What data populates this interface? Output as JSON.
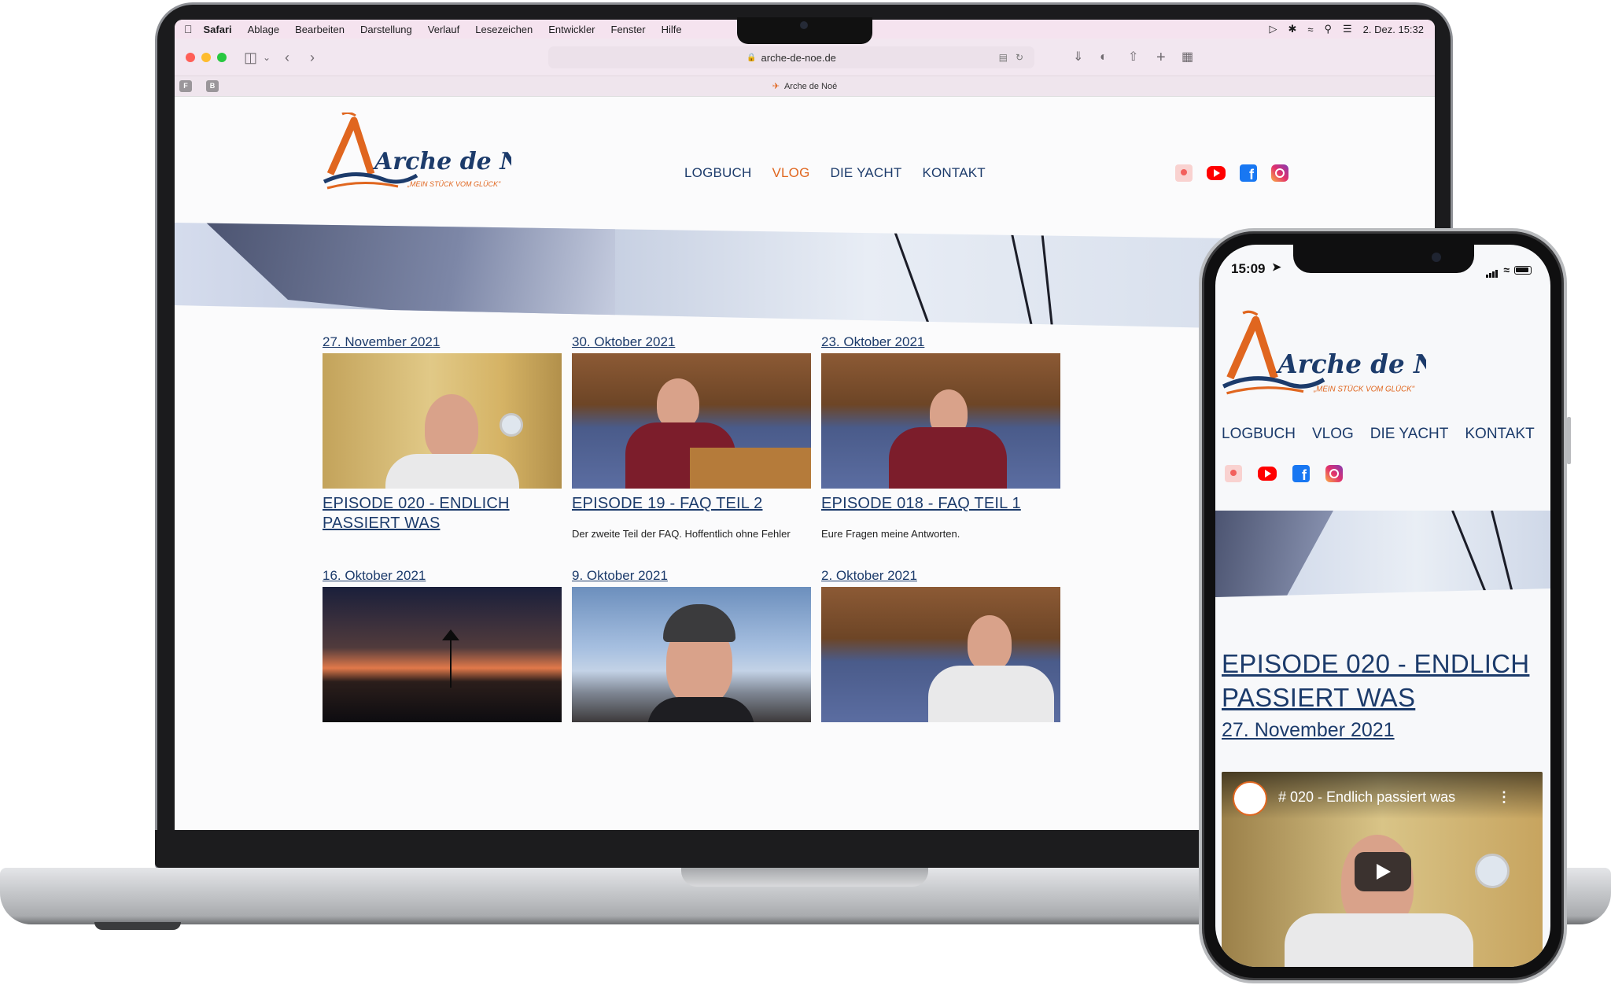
{
  "colors": {
    "navy": "#1c3b6b",
    "accent_orange": "#e0661f",
    "menubar_pink": "#f5e3ef"
  },
  "menubar": {
    "apple_icon": "apple-icon",
    "items": [
      "Safari",
      "Ablage",
      "Bearbeiten",
      "Darstellung",
      "Verlauf",
      "Lesezeichen",
      "Entwickler",
      "Fenster",
      "Hilfe"
    ],
    "clock": "2. Dez.  15:32"
  },
  "safari": {
    "url": "arche-de-noe.de",
    "tab_title": "Arche de Noé",
    "favorites": [
      "F",
      "B"
    ]
  },
  "site": {
    "logo_text": "Arche de Noé",
    "logo_tagline": "„MEIN STÜCK VOM GLÜCK\"",
    "nav": [
      "LOGBUCH",
      "VLOG",
      "DIE YACHT",
      "KONTAKT"
    ],
    "active_nav": "VLOG",
    "social_icons": [
      "patreon-icon",
      "youtube-icon",
      "facebook-icon",
      "instagram-icon"
    ],
    "posts": [
      {
        "date": "27. November 2021",
        "title": "EPISODE 020 - ENDLICH PASSIERT WAS",
        "excerpt": ""
      },
      {
        "date": "30. Oktober 2021",
        "title": "EPISODE 19 - FAQ TEIL 2",
        "excerpt": "Der zweite Teil der FAQ. Hoffentlich ohne Fehler"
      },
      {
        "date": "23. Oktober 2021",
        "title": "EPISODE 018 - FAQ TEIL 1",
        "excerpt": "Eure Fragen meine Antworten."
      },
      {
        "date": "16. Oktober 2021",
        "title": "",
        "excerpt": ""
      },
      {
        "date": "9. Oktober 2021",
        "title": "",
        "excerpt": ""
      },
      {
        "date": "2. Oktober 2021",
        "title": "",
        "excerpt": ""
      }
    ]
  },
  "phone": {
    "time": "15:09",
    "nav": [
      "LOGBUCH",
      "VLOG",
      "DIE YACHT",
      "KONTAKT"
    ],
    "episode_title": "EPISODE 020 - ENDLICH PASSIERT WAS",
    "episode_date": "27. November 2021",
    "video_title": "# 020 - Endlich passiert was",
    "video_more": "⋮"
  }
}
